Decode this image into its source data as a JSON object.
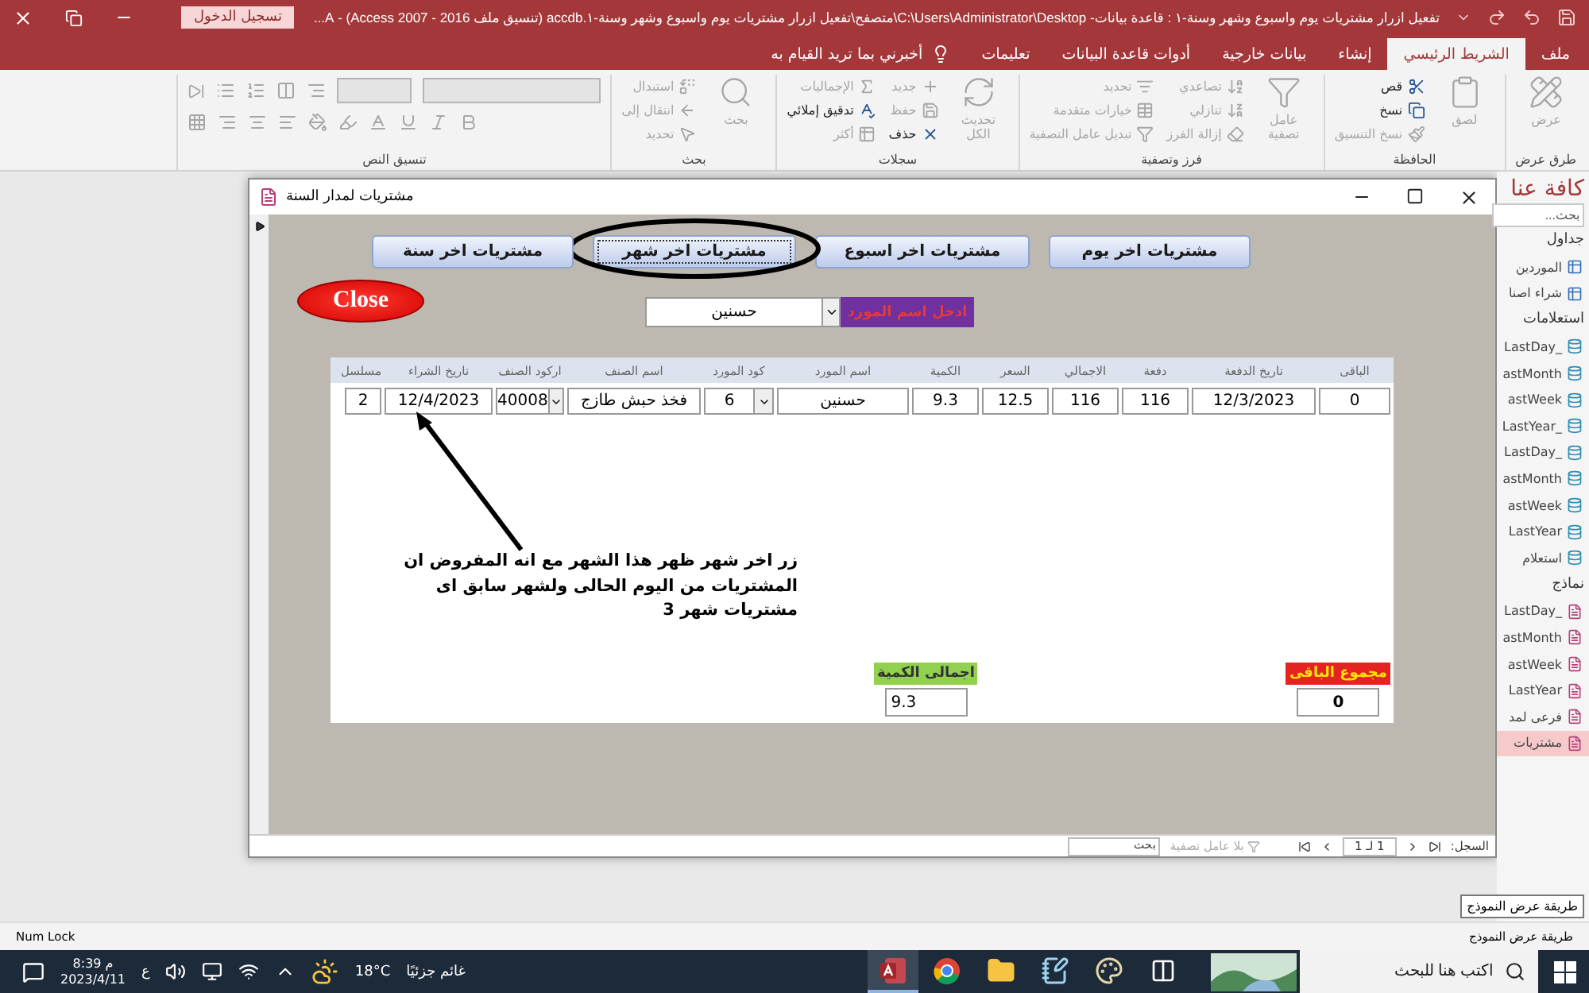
{
  "title_bar": {
    "title": "تفعيل ازرار مشتريات يوم واسبوع وشهر وسنة-١ : قاعدة بيانات- C:\\Users\\Administrator\\Desktop\\متصفح\\تفعيل ازرار مشتريات يوم واسبوع وشهر وسنة-١.accdb (تنسيق ملف Access 2007 - 2016) - A...",
    "sign_in": "تسجيل الدخول"
  },
  "ribbon_tabs": [
    {
      "label": "ملف",
      "selected": false
    },
    {
      "label": "الشريط الرئيسي",
      "selected": true
    },
    {
      "label": "إنشاء",
      "selected": false
    },
    {
      "label": "بيانات خارجية",
      "selected": false
    },
    {
      "label": "أدوات قاعدة البيانات",
      "selected": false
    },
    {
      "label": "تعليمات",
      "selected": false
    }
  ],
  "tell_me": "أخبرني بما تريد القيام به",
  "ribbon_groups": [
    {
      "title": "طرق عرض",
      "kind": "commands",
      "items": [
        {
          "label": "عرض",
          "kind": "large",
          "disabled": true
        }
      ]
    },
    {
      "title": "الحافظة",
      "kind": "commands",
      "items": [
        {
          "label": "لصق",
          "kind": "large",
          "disabled": true
        },
        {
          "label": "قص",
          "kind": "small",
          "disabled": false
        },
        {
          "label": "نسخ",
          "kind": "small",
          "disabled": false
        },
        {
          "label": "نسخ التنسيق",
          "kind": "small",
          "disabled": true
        }
      ]
    },
    {
      "title": "فرز وتصفية",
      "kind": "commands",
      "items": [
        {
          "label": "عامل تصفية",
          "kind": "large",
          "disabled": true
        },
        {
          "label": "تصاعدي",
          "kind": "small",
          "disabled": true
        },
        {
          "label": "تنازلي",
          "kind": "small",
          "disabled": true
        },
        {
          "label": "إزالة الفرز",
          "kind": "small",
          "disabled": true
        },
        {
          "label": "تحديد",
          "kind": "small",
          "disabled": true
        },
        {
          "label": "خيارات متقدمة",
          "kind": "small",
          "disabled": true
        },
        {
          "label": "تبديل عامل التصفية",
          "kind": "small",
          "disabled": true
        }
      ]
    },
    {
      "title": "سجلات",
      "kind": "commands",
      "items": [
        {
          "label": "تحديث الكل",
          "kind": "large",
          "disabled": true
        },
        {
          "label": "جديد",
          "kind": "small",
          "disabled": true
        },
        {
          "label": "حفظ",
          "kind": "small",
          "disabled": true
        },
        {
          "label": "حذف",
          "kind": "small",
          "disabled": false
        },
        {
          "label": "الإجماليات",
          "kind": "small",
          "disabled": true
        },
        {
          "label": "تدقيق إملائي",
          "kind": "small",
          "disabled": false
        },
        {
          "label": "أكثر",
          "kind": "small",
          "disabled": true
        }
      ]
    },
    {
      "title": "بحث",
      "kind": "commands",
      "items": [
        {
          "label": "بحث",
          "kind": "large",
          "disabled": true
        },
        {
          "label": "استبدال",
          "kind": "small",
          "disabled": true
        },
        {
          "label": "انتقال إلى",
          "kind": "small",
          "disabled": true
        },
        {
          "label": "تحديد",
          "kind": "small",
          "disabled": true
        }
      ]
    },
    {
      "title": "تنسيق النص",
      "kind": "format"
    }
  ],
  "form": {
    "title": "مشتريات لمدار السنة",
    "buttons": [
      {
        "label": "مشتريات اخر يوم",
        "circled": false
      },
      {
        "label": "مشتريات اخر اسبوع",
        "circled": false
      },
      {
        "label": "مشتريات اخر شهر",
        "circled": true
      },
      {
        "label": "مشتريات اخر سنة",
        "circled": false
      }
    ],
    "close_button": "Close",
    "supplier_label": "ادخل اسم المورد",
    "supplier_value": "حسنين",
    "table": {
      "columns": [
        "الباقى",
        "تاريخ الدفعة",
        "دفعة",
        "الاجمالي",
        "السعر",
        "الكمية",
        "اسم المورد",
        "كود المورد",
        "اسم الصنف",
        "اركود الصنف",
        "تاريخ الشراء",
        "مسلسل"
      ],
      "rows": [
        {
          "cells": [
            {
              "value": "0",
              "kind": "text"
            },
            {
              "value": "12/3/2023",
              "kind": "text"
            },
            {
              "value": "116",
              "kind": "text"
            },
            {
              "value": "116",
              "kind": "text"
            },
            {
              "value": "12.5",
              "kind": "text"
            },
            {
              "value": "9.3",
              "kind": "text"
            },
            {
              "value": "حسنين",
              "kind": "text"
            },
            {
              "value": "6",
              "kind": "combo"
            },
            {
              "value": "فخذ حبش طازج",
              "kind": "text"
            },
            {
              "value": "40008",
              "kind": "combo"
            },
            {
              "value": "12/4/2023",
              "kind": "text"
            },
            {
              "value": "2",
              "kind": "text"
            }
          ]
        }
      ]
    },
    "annotation": "زر اخر شهر ظهر هذا الشهر مع انه المفروض ان\nالمشتريات من اليوم الحالى ولشهر سابق اى\nمشتريات شهر 3",
    "totals": [
      {
        "label": "مجموع الباقى",
        "value": "0",
        "color": "#e52421"
      },
      {
        "label": "اجمالى الكمية",
        "value": "9.3",
        "color": "#92d050"
      }
    ],
    "record_nav": {
      "label": "السجل:",
      "position": "1 لـ 1",
      "filter": "بلا عامل تصفية",
      "filter_disabled": true,
      "search": {
        "placeholder": "بحث"
      }
    }
  },
  "nav_pane": {
    "title": "كافة عنا",
    "search": {
      "placeholder": "بحث..."
    },
    "sections": [
      {
        "title": "جداول",
        "items": [
          {
            "label": "الموردين",
            "kind": "table",
            "selected": false
          },
          {
            "label": "شراء اصنا",
            "kind": "table",
            "selected": false
          }
        ]
      },
      {
        "title": "استعلامات",
        "items": [
          {
            "label": "_LastDay",
            "kind": "query",
            "selected": false
          },
          {
            "label": "astMonth",
            "kind": "query",
            "selected": false
          },
          {
            "label": "astWeek",
            "kind": "query",
            "selected": false
          },
          {
            "label": "_LastYear",
            "kind": "query",
            "selected": false
          },
          {
            "label": "_LastDay",
            "kind": "query",
            "selected": false
          },
          {
            "label": "astMonth",
            "kind": "query",
            "selected": false
          },
          {
            "label": "astWeek",
            "kind": "query",
            "selected": false
          },
          {
            "label": "LastYear",
            "kind": "query",
            "selected": false
          },
          {
            "label": "استعلام",
            "kind": "query",
            "selected": false
          }
        ]
      },
      {
        "title": "نماذج",
        "items": [
          {
            "label": "_LastDay",
            "kind": "form",
            "selected": false
          },
          {
            "label": "astMonth",
            "kind": "form",
            "selected": false
          },
          {
            "label": "astWeek",
            "kind": "form",
            "selected": false
          },
          {
            "label": "LastYear",
            "kind": "form",
            "selected": false
          },
          {
            "label": "فرعى لمد",
            "kind": "form",
            "selected": false
          },
          {
            "label": "مشتريات",
            "kind": "form",
            "selected": true
          }
        ]
      }
    ]
  },
  "tooltip": "طريقة عرض النموذج",
  "status_bar": {
    "num_lock": "Num Lock",
    "view_mode": "طريقة عرض النموذج"
  },
  "taskbar": {
    "search": {
      "placeholder": "اكتب هنا للبحث"
    },
    "apps": [
      {
        "kind": "taskview",
        "selected": false
      },
      {
        "kind": "paint",
        "selected": false
      },
      {
        "kind": "notepad",
        "selected": false
      },
      {
        "kind": "explorer",
        "selected": false
      },
      {
        "kind": "chrome",
        "selected": false
      },
      {
        "kind": "access",
        "selected": true
      }
    ],
    "weather": {
      "temperature": "18°C",
      "condition": "غائم جزئيًا"
    },
    "language": "ع",
    "time": "8:39 م",
    "date": "2023/4/11"
  }
}
